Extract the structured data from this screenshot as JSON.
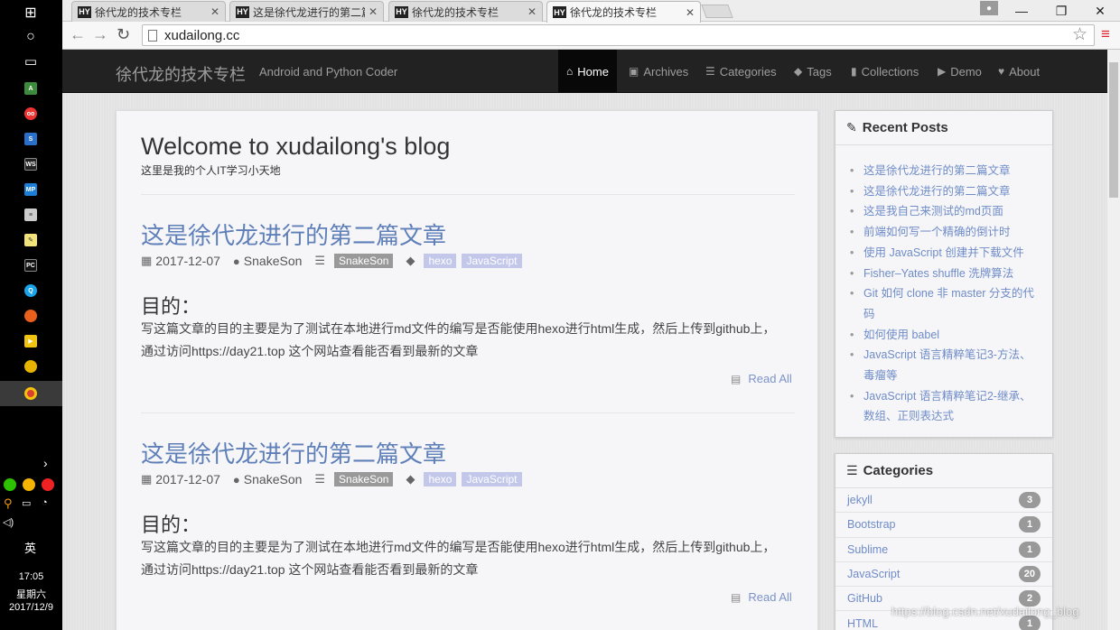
{
  "taskbar": {
    "active_app": "Chrome",
    "tray_lang": "英",
    "clock_time": "17:05",
    "clock_day": "星期六",
    "clock_date": "2017/12/9"
  },
  "browser": {
    "tabs": [
      {
        "favicon": "HY",
        "title": "徐代龙的技术专栏",
        "active": false
      },
      {
        "favicon": "HY",
        "title": "这是徐代龙进行的第二篇",
        "active": false
      },
      {
        "favicon": "HY",
        "title": "徐代龙的技术专栏",
        "active": false
      },
      {
        "favicon": "HY",
        "title": "徐代龙的技术专栏",
        "active": true
      }
    ],
    "url": "xudailong.cc"
  },
  "navbar": {
    "brand": "徐代龙的技术专栏",
    "tagline": "Android and Python Coder",
    "items": [
      {
        "icon": "home-icon",
        "glyph": "⌂",
        "label": "Home",
        "active": true
      },
      {
        "icon": "archive-icon",
        "glyph": "▣",
        "label": "Archives",
        "active": false
      },
      {
        "icon": "list-icon",
        "glyph": "☰",
        "label": "Categories",
        "active": false
      },
      {
        "icon": "tags-icon",
        "glyph": "◆",
        "label": "Tags",
        "active": false
      },
      {
        "icon": "bookmark-icon",
        "glyph": "▮",
        "label": "Collections",
        "active": false
      },
      {
        "icon": "play-icon",
        "glyph": "▶",
        "label": "Demo",
        "active": false
      },
      {
        "icon": "heart-icon",
        "glyph": "♥",
        "label": "About",
        "active": false
      }
    ]
  },
  "main": {
    "title": "Welcome to xudailong's blog",
    "subtitle": "这里是我的个人IT学习小天地",
    "posts": [
      {
        "title": "这是徐代龙进行的第二篇文章",
        "date": "2017-12-07",
        "author": "SnakeSon",
        "category": "SnakeSon",
        "tags": [
          "hexo",
          "JavaScript"
        ],
        "heading": "目的：",
        "body": "写这篇文章的目的主要是为了测试在本地进行md文件的编写是否能使用hexo进行html生成，然后上传到github上，通过访问https://day21.top 这个网站查看能否看到最新的文章",
        "read_all": "Read All"
      },
      {
        "title": "这是徐代龙进行的第二篇文章",
        "date": "2017-12-07",
        "author": "SnakeSon",
        "category": "SnakeSon",
        "tags": [
          "hexo",
          "JavaScript"
        ],
        "heading": "目的：",
        "body": "写这篇文章的目的主要是为了测试在本地进行md文件的编写是否能使用hexo进行html生成，然后上传到github上，通过访问https://day21.top 这个网站查看能否看到最新的文章",
        "read_all": "Read All"
      }
    ]
  },
  "sidebar": {
    "recent_title": "Recent Posts",
    "recent_posts": [
      "这是徐代龙进行的第二篇文章",
      "这是徐代龙进行的第二篇文章",
      "这是我自己来测试的md页面",
      "前端如何写一个精确的倒计时",
      "使用 JavaScript 创建并下载文件",
      "Fisher–Yates shuffle 洗牌算法",
      "Git 如何 clone 非 master 分支的代码",
      "如何使用 babel",
      "JavaScript 语言精粹笔记3-方法、毒瘤等",
      "JavaScript 语言精粹笔记2-继承、数组、正则表达式"
    ],
    "categories_title": "Categories",
    "categories": [
      {
        "name": "jekyll",
        "count": "3"
      },
      {
        "name": "Bootstrap",
        "count": "1"
      },
      {
        "name": "Sublime",
        "count": "1"
      },
      {
        "name": "JavaScript",
        "count": "20"
      },
      {
        "name": "GitHub",
        "count": "2"
      },
      {
        "name": "HTML",
        "count": "1"
      }
    ]
  },
  "watermark": "https://blog.csdn.net/xudailong_blog"
}
